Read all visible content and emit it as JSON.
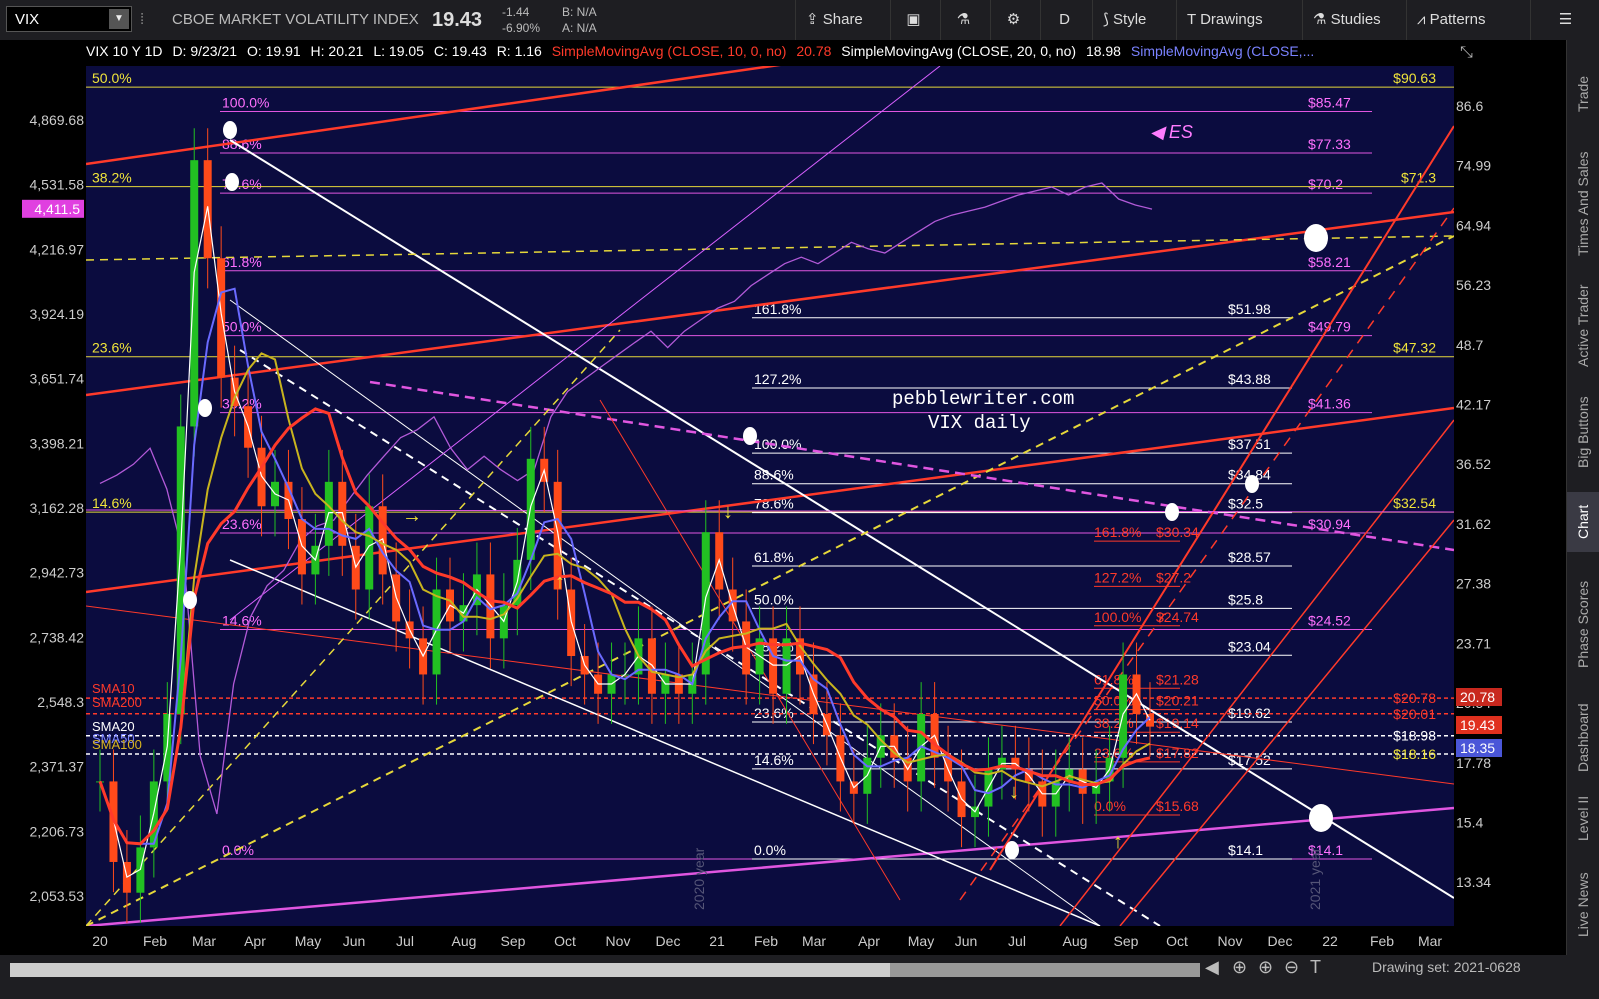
{
  "toolbar": {
    "symbol": "VIX",
    "name": "CBOE MARKET VOLATILITY INDEX",
    "last": "19.43",
    "change": "-1.44",
    "change_pct": "-6.90%",
    "bid": "B: N/A",
    "ask": "A: N/A",
    "share": "Share",
    "period": "D",
    "style": "Style",
    "drawings": "Drawings",
    "studies": "Studies",
    "patterns": "Patterns"
  },
  "infobar": {
    "title": "VIX 10 Y 1D",
    "date": "D: 9/23/21",
    "open": "O: 19.91",
    "high": "H: 20.21",
    "low": "L: 19.05",
    "close": "C: 19.43",
    "range": "R: 1.16",
    "sma10": "SimpleMovingAvg (CLOSE, 10, 0, no)",
    "sma10_val": "20.78",
    "sma20": "SimpleMovingAvg (CLOSE, 20, 0, no)",
    "sma20_val": "18.98",
    "sma50": "SimpleMovingAvg (CLOSE,..."
  },
  "sidebar": [
    "Trade",
    "Times And Sales",
    "Active Trader",
    "Big Buttons",
    "Chart",
    "Phase Scores",
    "Dashboard",
    "Level II",
    "Live News"
  ],
  "bottom": {
    "drawing_set": "Drawing set: 2021-0628"
  },
  "chart_data": {
    "type": "candlestick",
    "title": "VIX daily",
    "watermark": "pebblewriter.com",
    "overlay_label": "ES",
    "x_ticks": [
      "20",
      "Feb",
      "Mar",
      "Apr",
      "May",
      "Jun",
      "Jul",
      "Aug",
      "Sep",
      "Oct",
      "Nov",
      "Dec",
      "21",
      "Feb",
      "Mar",
      "Apr",
      "May",
      "Jun",
      "Jul",
      "Aug",
      "Sep",
      "Oct",
      "Nov",
      "Dec",
      "22",
      "Feb",
      "Mar"
    ],
    "x_year_labels": [
      "2020 year",
      "2021 year"
    ],
    "right_axis_ticks": [
      "86.6",
      "74.99",
      "64.94",
      "56.23",
      "48.7",
      "42.17",
      "36.52",
      "31.62",
      "27.38",
      "23.71",
      "20.54",
      "17.78",
      "15.4",
      "13.34"
    ],
    "left_axis_ticks": [
      "4,869.68",
      "4,531.58",
      "4,216.97",
      "3,924.19",
      "3,651.74",
      "3,398.21",
      "3,162.28",
      "2,942.73",
      "2,738.42",
      "2,548.3",
      "2,371.37",
      "2,206.73",
      "2,053.53"
    ],
    "left_axis_current": "4,411.5",
    "price_markers": [
      {
        "label": "20.78",
        "color": "#c8281e"
      },
      {
        "label": "19.43",
        "color": "#e0301e"
      },
      {
        "label": "18.35",
        "color": "#4a56d8"
      }
    ],
    "sma_labels": [
      {
        "name": "SMA10",
        "color": "#ff3a2a"
      },
      {
        "name": "SMA200",
        "color": "#ff3a2a"
      },
      {
        "name": "SMA20",
        "color": "#ffffff"
      },
      {
        "name": "SMA50",
        "color": "#7a82ff"
      },
      {
        "name": "SMA100",
        "color": "#d8b41e"
      }
    ],
    "fib_left_pink": [
      {
        "pct": "100.0%",
        "value": 85.47
      },
      {
        "pct": "88.6%",
        "value": 77.33
      },
      {
        "pct": "78.6%",
        "value": 70.2
      },
      {
        "pct": "61.8%",
        "value": 58.21
      },
      {
        "pct": "50.0%",
        "value": 49.79
      },
      {
        "pct": "38.2%",
        "value": 41.36
      },
      {
        "pct": "23.6%",
        "value": 30.94
      },
      {
        "pct": "14.6%",
        "value": 24.52
      },
      {
        "pct": "0.0%",
        "value": 14.1
      }
    ],
    "fib_yellow": [
      {
        "pct": "50.0%",
        "value": 90.63
      },
      {
        "pct": "38.2%",
        "value": 71.3
      },
      {
        "pct": "23.6%",
        "value": 47.32
      },
      {
        "pct": "14.6%",
        "value": 32.54
      }
    ],
    "fib_white": [
      {
        "pct": "161.8%",
        "value": 51.98
      },
      {
        "pct": "127.2%",
        "value": 43.88
      },
      {
        "pct": "100.0%",
        "value": 37.51
      },
      {
        "pct": "88.6%",
        "value": 34.84
      },
      {
        "pct": "78.6%",
        "value": 32.5
      },
      {
        "pct": "61.8%",
        "value": 28.57
      },
      {
        "pct": "50.0%",
        "value": 25.8
      },
      {
        "pct": "38.2%",
        "value": 23.04
      },
      {
        "pct": "23.6%",
        "value": 19.62
      },
      {
        "pct": "14.6%",
        "value": 17.52
      },
      {
        "pct": "0.0%",
        "value": 14.1
      }
    ],
    "fib_red": [
      {
        "pct": "161.8%",
        "value": 30.34
      },
      {
        "pct": "127.2%",
        "value": 27.2
      },
      {
        "pct": "100.0%",
        "value": 24.74
      },
      {
        "pct": "61.8%",
        "value": 21.28
      },
      {
        "pct": "50.0%",
        "value": 20.21
      },
      {
        "pct": "38.2%",
        "value": 19.14
      },
      {
        "pct": "23.6%",
        "value": 17.82
      },
      {
        "pct": "0.0%",
        "value": 15.68
      }
    ],
    "right_extra_labels": [
      {
        "label": "$20.78",
        "value": 20.78
      },
      {
        "label": "$20.01",
        "value": 20.01
      },
      {
        "label": "$18.98",
        "value": 18.98
      },
      {
        "label": "$18.16",
        "value": 18.16
      }
    ],
    "vix_path": [
      [
        0,
        17
      ],
      [
        1,
        14
      ],
      [
        2,
        13
      ],
      [
        3,
        14.5
      ],
      [
        4,
        17
      ],
      [
        5,
        20
      ],
      [
        6,
        40
      ],
      [
        7,
        76
      ],
      [
        8,
        60
      ],
      [
        9,
        45
      ],
      [
        10,
        42
      ],
      [
        11,
        38
      ],
      [
        12,
        33
      ],
      [
        13,
        35
      ],
      [
        14,
        32
      ],
      [
        15,
        28
      ],
      [
        16,
        30
      ],
      [
        17,
        35
      ],
      [
        18,
        30
      ],
      [
        19,
        27
      ],
      [
        20,
        33
      ],
      [
        21,
        28
      ],
      [
        22,
        25
      ],
      [
        23,
        24
      ],
      [
        24,
        22
      ],
      [
        25,
        27
      ],
      [
        26,
        25
      ],
      [
        27,
        26
      ],
      [
        28,
        28
      ],
      [
        29,
        24
      ],
      [
        30,
        26
      ],
      [
        31,
        29
      ],
      [
        32,
        37
      ],
      [
        33,
        35
      ],
      [
        34,
        27
      ],
      [
        35,
        23
      ],
      [
        36,
        22
      ],
      [
        37,
        21
      ],
      [
        38,
        22
      ],
      [
        39,
        22
      ],
      [
        40,
        24
      ],
      [
        41,
        21
      ],
      [
        42,
        22
      ],
      [
        43,
        21
      ],
      [
        44,
        22
      ],
      [
        45,
        31
      ],
      [
        46,
        27
      ],
      [
        47,
        25
      ],
      [
        48,
        22
      ],
      [
        49,
        24
      ],
      [
        50,
        21
      ],
      [
        51,
        24
      ],
      [
        52,
        22
      ],
      [
        53,
        20
      ],
      [
        54,
        19
      ],
      [
        55,
        17
      ],
      [
        56,
        16.5
      ],
      [
        57,
        18
      ],
      [
        58,
        19
      ],
      [
        59,
        18
      ],
      [
        60,
        17
      ],
      [
        61,
        20
      ],
      [
        62,
        18
      ],
      [
        63,
        17
      ],
      [
        64,
        15.6
      ],
      [
        65,
        16
      ],
      [
        66,
        17.5
      ],
      [
        67,
        18
      ],
      [
        68,
        17.5
      ],
      [
        69,
        17
      ],
      [
        70,
        16
      ],
      [
        71,
        17
      ],
      [
        72,
        17.5
      ],
      [
        73,
        16.5
      ],
      [
        74,
        17
      ],
      [
        75,
        18
      ],
      [
        76,
        22
      ],
      [
        77,
        20
      ],
      [
        78,
        19.4
      ]
    ],
    "es_path": [
      [
        0,
        3250
      ],
      [
        1,
        3280
      ],
      [
        2,
        3320
      ],
      [
        3,
        3380
      ],
      [
        4,
        3230
      ],
      [
        5,
        3000
      ],
      [
        6,
        2400
      ],
      [
        7,
        2250
      ],
      [
        8,
        2600
      ],
      [
        9,
        2800
      ],
      [
        10,
        2900
      ],
      [
        11,
        2950
      ],
      [
        12,
        3050
      ],
      [
        13,
        3100
      ],
      [
        14,
        3120
      ],
      [
        15,
        3200
      ],
      [
        16,
        3280
      ],
      [
        17,
        3350
      ],
      [
        18,
        3420
      ],
      [
        19,
        3450
      ],
      [
        20,
        3500
      ],
      [
        21,
        3380
      ],
      [
        22,
        3300
      ],
      [
        23,
        3350
      ],
      [
        24,
        3300
      ],
      [
        25,
        3260
      ],
      [
        26,
        3300
      ],
      [
        27,
        3500
      ],
      [
        28,
        3600
      ],
      [
        29,
        3650
      ],
      [
        30,
        3700
      ],
      [
        31,
        3750
      ],
      [
        32,
        3800
      ],
      [
        33,
        3850
      ],
      [
        34,
        3780
      ],
      [
        35,
        3850
      ],
      [
        36,
        3900
      ],
      [
        37,
        3950
      ],
      [
        38,
        3980
      ],
      [
        39,
        4050
      ],
      [
        40,
        4100
      ],
      [
        41,
        4150
      ],
      [
        42,
        4180
      ],
      [
        43,
        4150
      ],
      [
        44,
        4200
      ],
      [
        45,
        4250
      ],
      [
        46,
        4220
      ],
      [
        47,
        4200
      ],
      [
        48,
        4250
      ],
      [
        49,
        4300
      ],
      [
        50,
        4350
      ],
      [
        51,
        4380
      ],
      [
        52,
        4400
      ],
      [
        53,
        4420
      ],
      [
        54,
        4450
      ],
      [
        55,
        4480
      ],
      [
        56,
        4500
      ],
      [
        57,
        4520
      ],
      [
        58,
        4480
      ],
      [
        59,
        4520
      ],
      [
        60,
        4540
      ],
      [
        61,
        4460
      ],
      [
        62,
        4430
      ],
      [
        63,
        4410
      ]
    ]
  }
}
